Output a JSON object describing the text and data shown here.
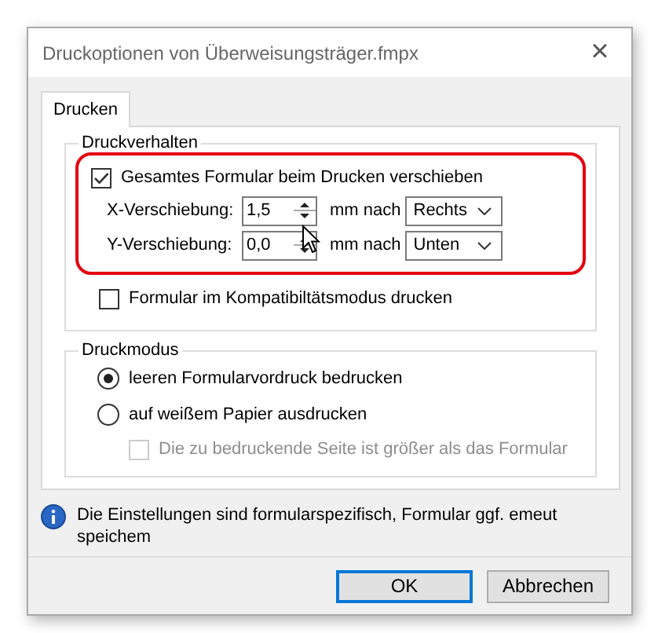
{
  "window": {
    "title": "Druckoptionen von Überweisungsträger.fmpx",
    "close": "×"
  },
  "tabs": [
    {
      "label": "Drucken",
      "selected": true
    }
  ],
  "behavior_group": {
    "legend": "Druckverhalten",
    "shift": {
      "label": "Gesamtes Formular beim Drucken verschieben",
      "checked": true,
      "highlighted": true
    },
    "offsets": [
      {
        "label": "X-Verschiebung:",
        "value": "1,5",
        "unit": "mm nach",
        "direction": "Rechts"
      },
      {
        "label": "Y-Verschiebung:",
        "value": "0,0",
        "unit": "mm nach",
        "direction": "Unten"
      }
    ],
    "compat": {
      "label": "Formular im Kompatibiltätsmodus drucken",
      "checked": false
    }
  },
  "mode_group": {
    "legend": "Druckmodus",
    "options": [
      {
        "label": "leeren Formularvordruck bedrucken",
        "selected": true
      },
      {
        "label": "auf weißem Papier ausdrucken",
        "selected": false
      }
    ],
    "larger_page": {
      "label": "Die zu bedruckende Seite ist größer als das Formular",
      "checked": false,
      "disabled": true
    }
  },
  "info": "Die Einstellungen sind formularspezifisch, Formular ggf. emeut speichem",
  "buttons": [
    {
      "label": "OK",
      "default": true
    },
    {
      "label": "Abbrechen",
      "default": false
    }
  ]
}
